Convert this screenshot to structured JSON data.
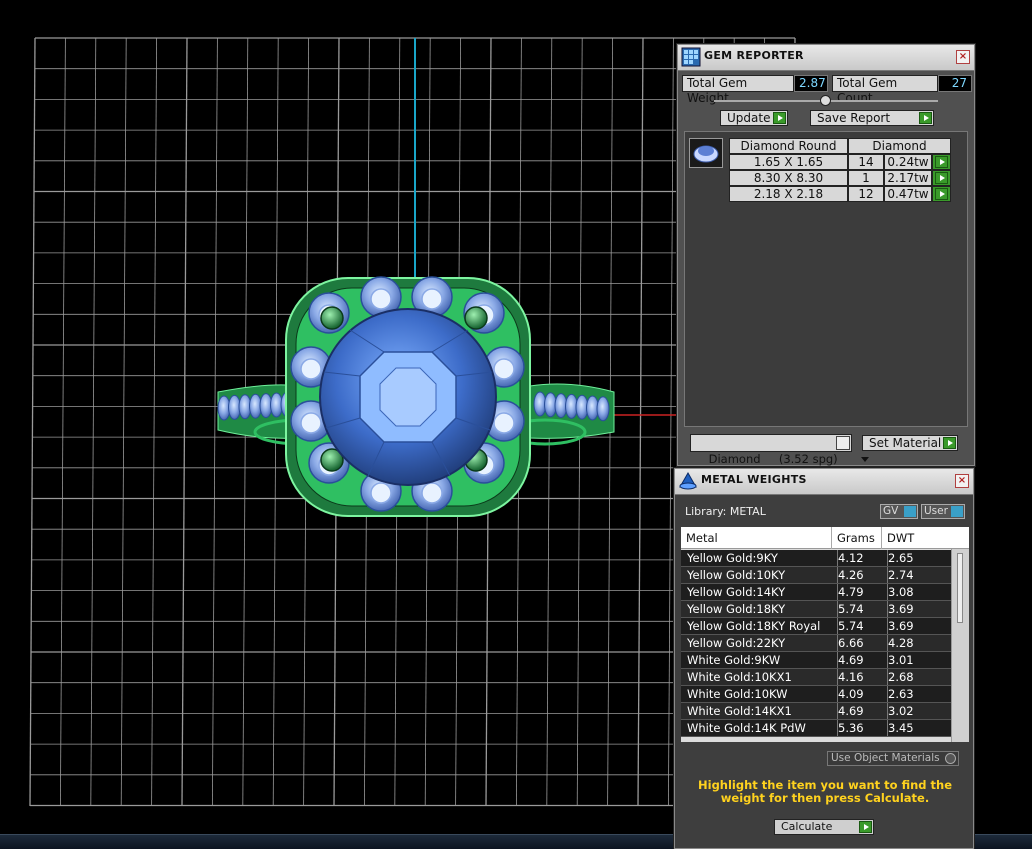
{
  "gem_reporter": {
    "title": "GEM REPORTER",
    "close": "×",
    "total_weight_label": "Total Gem Weight",
    "total_weight_value": "2.87",
    "total_count_label": "Total Gem Count",
    "total_count_value": "27",
    "update_label": "Update",
    "save_report_label": "Save Report",
    "table_header_1": "Diamond Round",
    "table_header_2": "Diamond",
    "rows": [
      {
        "size": "1.65 X 1.65",
        "count": "14",
        "weight": "0.24tw"
      },
      {
        "size": "8.30 X 8.30",
        "count": "1",
        "weight": "2.17tw"
      },
      {
        "size": "2.18 X 2.18",
        "count": "12",
        "weight": "0.47tw"
      }
    ],
    "material_select": "Diamond     (3.52 spg)",
    "set_material_label": "Set Material"
  },
  "metal_weights": {
    "title": "METAL WEIGHTS",
    "close": "×",
    "library_label": "Library: METAL",
    "gv_label": "GV",
    "user_label": "User",
    "col_metal": "Metal",
    "col_grams": "Grams",
    "col_dwt": "DWT",
    "rows": [
      {
        "metal": "Yellow Gold:9KY",
        "grams": "4.12",
        "dwt": "2.65"
      },
      {
        "metal": "Yellow Gold:10KY",
        "grams": "4.26",
        "dwt": "2.74"
      },
      {
        "metal": "Yellow Gold:14KY",
        "grams": "4.79",
        "dwt": "3.08"
      },
      {
        "metal": "Yellow Gold:18KY",
        "grams": "5.74",
        "dwt": "3.69"
      },
      {
        "metal": "Yellow Gold:18KY Royal",
        "grams": "5.74",
        "dwt": "3.69"
      },
      {
        "metal": "Yellow Gold:22KY",
        "grams": "6.66",
        "dwt": "4.28"
      },
      {
        "metal": "White Gold:9KW",
        "grams": "4.69",
        "dwt": "3.01"
      },
      {
        "metal": "White Gold:10KX1",
        "grams": "4.16",
        "dwt": "2.68"
      },
      {
        "metal": "White Gold:10KW",
        "grams": "4.09",
        "dwt": "2.63"
      },
      {
        "metal": "White Gold:14KX1",
        "grams": "4.69",
        "dwt": "3.02"
      },
      {
        "metal": "White Gold:14K PdW",
        "grams": "5.36",
        "dwt": "3.45"
      }
    ],
    "use_object_materials": "Use Object Materials",
    "hint": "Highlight the item you want to find the weight for then press Calculate.",
    "calculate_label": "Calculate"
  },
  "colors": {
    "grid": "#9a9a9a",
    "axis_z": "#19a6c8",
    "axis_x": "#cc2222",
    "metal": "#2fbf62",
    "gem": "#3f6fd0",
    "hint_text": "#ffd21e"
  }
}
